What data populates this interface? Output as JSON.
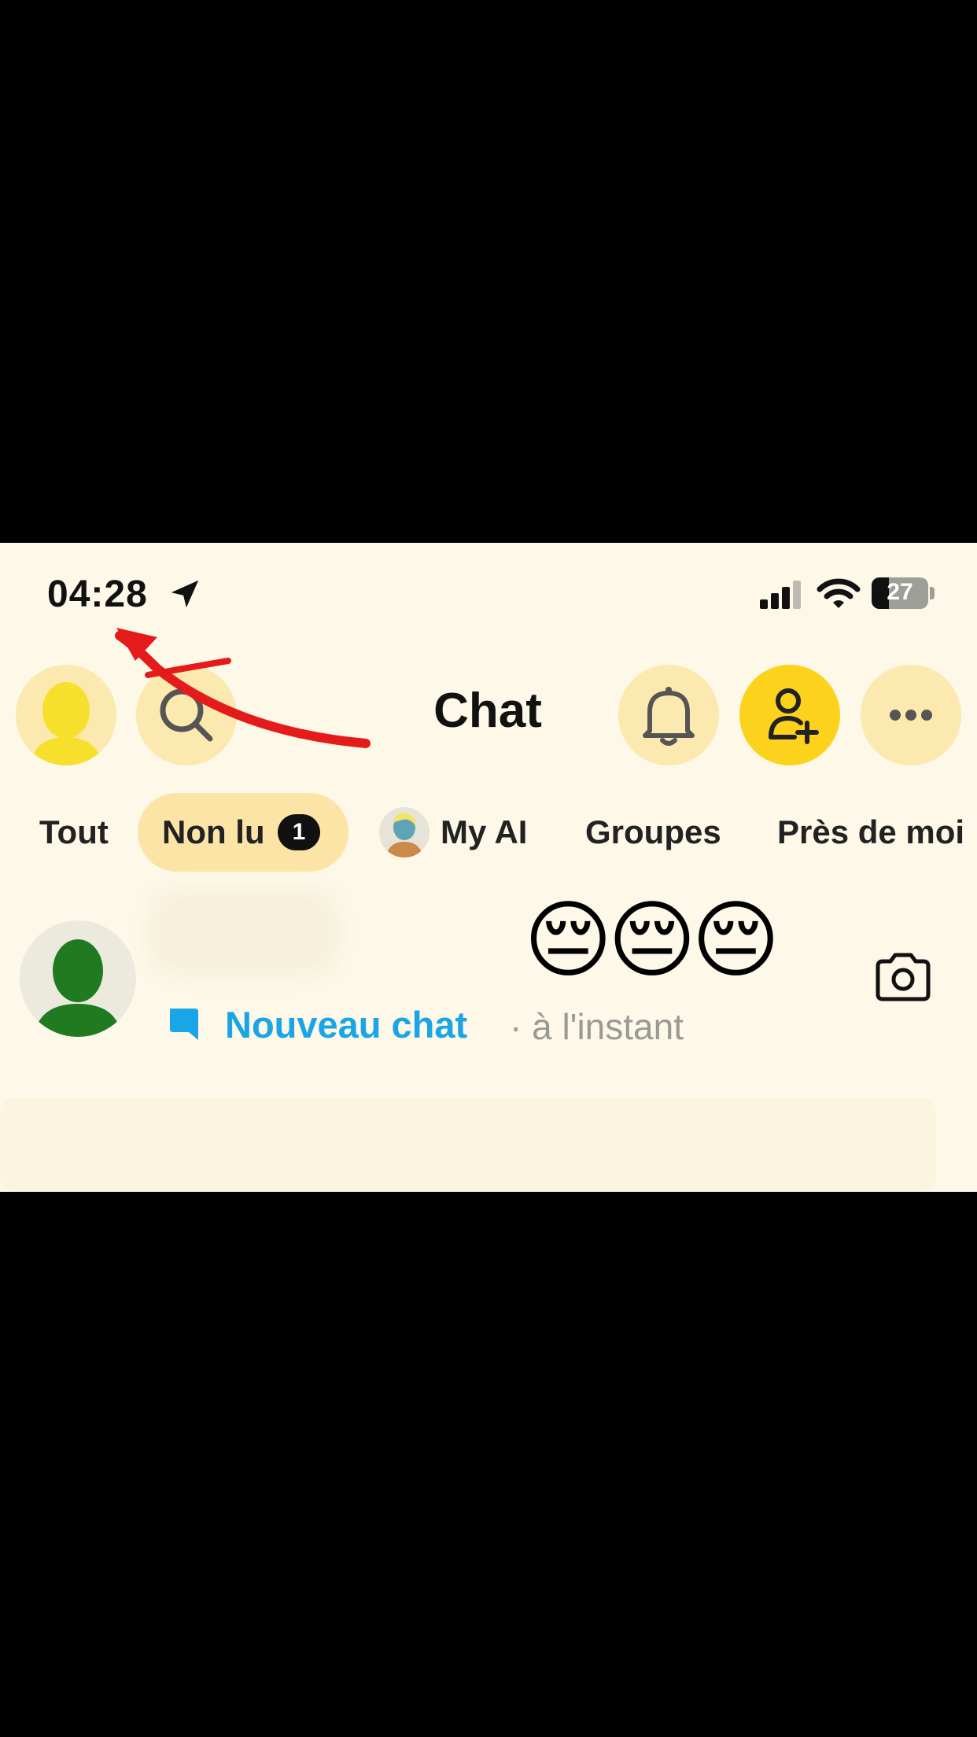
{
  "status_bar": {
    "time": "04:28",
    "battery": "27",
    "icons": [
      "location-arrow-icon",
      "signal-icon",
      "wifi-icon",
      "battery-icon"
    ]
  },
  "header": {
    "title": "Chat",
    "icons": [
      "profile-avatar",
      "search-icon",
      "bell-icon",
      "add-friend-icon",
      "more-icon"
    ]
  },
  "tabs": [
    {
      "label": "Tout"
    },
    {
      "label": "Non lu",
      "badge": "1"
    },
    {
      "label": "My AI"
    },
    {
      "label": "Groupes"
    },
    {
      "label": "Près de moi"
    }
  ],
  "chat_row": {
    "emojis": "😔😔😔",
    "status": "Nouveau chat",
    "time": "· à l'instant"
  },
  "colors": {
    "background": "#fdf8e7",
    "accent_yellow": "#fcd21c",
    "chat_blue": "#1aa5e6",
    "annotation_red": "#e51b1b"
  }
}
